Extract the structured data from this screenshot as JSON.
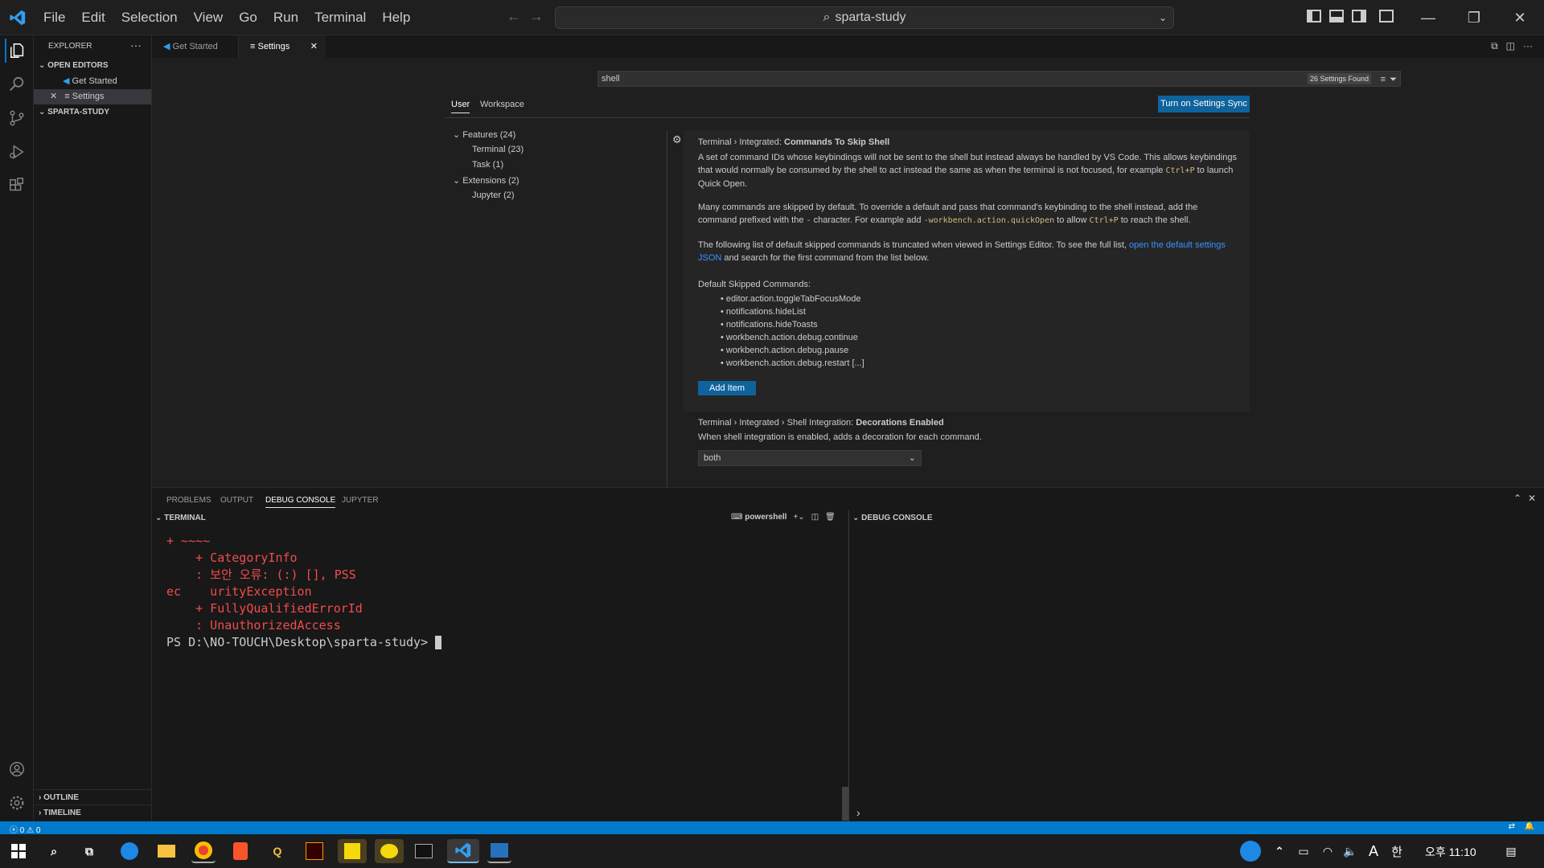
{
  "titlebar": {
    "menu": [
      "File",
      "Edit",
      "Selection",
      "View",
      "Go",
      "Run",
      "Terminal",
      "Help"
    ],
    "search_text": "sparta-study"
  },
  "sidebar": {
    "title": "EXPLORER",
    "open_editors_label": "OPEN EDITORS",
    "open_editors": [
      "Get Started",
      "Settings"
    ],
    "folder_label": "SPARTA-STUDY",
    "outline_label": "OUTLINE",
    "timeline_label": "TIMELINE"
  },
  "tabs": [
    "Get Started",
    "Settings"
  ],
  "settings": {
    "search_value": "shell",
    "found_count": "26 Settings Found",
    "scope_tabs": [
      "User",
      "Workspace"
    ],
    "sync_button": "Turn on Settings Sync",
    "toc": {
      "features": "Features (24)",
      "terminal": "Terminal (23)",
      "task": "Task (1)",
      "extensions": "Extensions (2)",
      "jupyter": "Jupyter (2)"
    },
    "skip_shell": {
      "title_prefix": "Terminal › Integrated: ",
      "title_name": "Commands To Skip Shell",
      "desc1a": "A set of command IDs whose keybindings will not be sent to the shell but instead always be handled by VS Code. This allows keybindings that would normally be consumed by the shell to act instead the same as when the terminal is not focused, for example ",
      "desc1_code": "Ctrl+P",
      "desc1b": " to launch Quick Open.",
      "desc2a": "Many commands are skipped by default. To override a default and pass that command's keybinding to the shell instead, add the command prefixed with the ",
      "desc2_dash": "-",
      "desc2b": " character. For example add ",
      "desc2_code1": "-workbench.action.quickOpen",
      "desc2c": " to allow ",
      "desc2_code2": "Ctrl+P",
      "desc2d": " to reach the shell.",
      "desc3a": "The following list of default skipped commands is truncated when viewed in Settings Editor. To see the full list, ",
      "desc3_link": "open the default settings JSON",
      "desc3b": " and search for the first command from the list below.",
      "list_label": "Default Skipped Commands:",
      "commands": [
        "editor.action.toggleTabFocusMode",
        "notifications.hideList",
        "notifications.hideToasts",
        "workbench.action.debug.continue",
        "workbench.action.debug.pause",
        "workbench.action.debug.restart [...]"
      ],
      "add_item": "Add Item"
    },
    "decorations": {
      "title_prefix": "Terminal › Integrated › Shell Integration: ",
      "title_name": "Decorations Enabled",
      "desc": "When shell integration is enabled, adds a decoration for each command.",
      "value": "both"
    }
  },
  "panel": {
    "tabs": [
      "PROBLEMS",
      "OUTPUT",
      "DEBUG CONSOLE",
      "JUPYTER"
    ],
    "terminal_label": "TERMINAL",
    "shell_name": "powershell",
    "debug_label": "DEBUG CONSOLE",
    "terminal_lines": [
      "+ ~~~~",
      "    + CategoryInfo",
      "    : 보안 오류: (:) [], PSS",
      "ec    urityException",
      "    + FullyQualifiedErrorId",
      "    : UnauthorizedAccess",
      "PS D:\\NO-TOUCH\\Desktop\\sparta-study> "
    ]
  },
  "statusbar": {
    "errors": "0",
    "warnings": "0"
  },
  "taskbar": {
    "time": "오후 11:10",
    "ime": "A",
    "ime2": "한"
  }
}
